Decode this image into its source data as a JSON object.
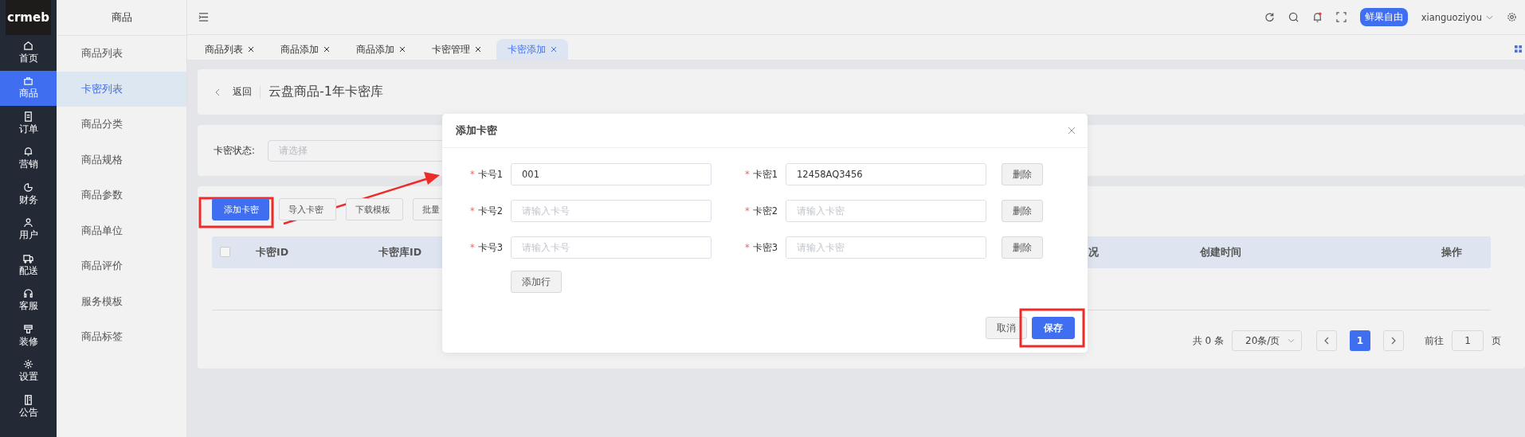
{
  "logo": "crmeb",
  "nav": [
    {
      "label": "首页",
      "selected": false
    },
    {
      "label": "商品",
      "selected": true
    },
    {
      "label": "订单",
      "selected": false
    },
    {
      "label": "营销",
      "selected": false
    },
    {
      "label": "财务",
      "selected": false
    },
    {
      "label": "用户",
      "selected": false
    },
    {
      "label": "配送",
      "selected": false
    },
    {
      "label": "客服",
      "selected": false
    },
    {
      "label": "装修",
      "selected": false
    },
    {
      "label": "设置",
      "selected": false
    },
    {
      "label": "公告",
      "selected": false
    }
  ],
  "submenu": {
    "title": "商品",
    "items": [
      {
        "label": "商品列表",
        "selected": false
      },
      {
        "label": "卡密列表",
        "selected": true
      },
      {
        "label": "商品分类",
        "selected": false
      },
      {
        "label": "商品规格",
        "selected": false
      },
      {
        "label": "商品参数",
        "selected": false
      },
      {
        "label": "商品单位",
        "selected": false
      },
      {
        "label": "商品评价",
        "selected": false
      },
      {
        "label": "服务模板",
        "selected": false
      },
      {
        "label": "商品标签",
        "selected": false
      }
    ]
  },
  "header": {
    "shop": "鲜果自由",
    "username": "xianguoziyou"
  },
  "tabs": [
    {
      "label": "商品列表",
      "selected": false
    },
    {
      "label": "商品添加",
      "selected": false
    },
    {
      "label": "商品添加",
      "selected": false
    },
    {
      "label": "卡密管理",
      "selected": false
    },
    {
      "label": "卡密添加",
      "selected": true
    }
  ],
  "page": {
    "back": "返回",
    "title": "云盘商品-1年卡密库"
  },
  "filter": {
    "label": "卡密状态:",
    "placeholder": "请选择"
  },
  "toolbar": [
    {
      "label": "添加卡密",
      "kind": "primary"
    },
    {
      "label": "导入卡密",
      "kind": "default"
    },
    {
      "label": "下载模板",
      "kind": "default"
    },
    {
      "label": "批量",
      "kind": "default"
    }
  ],
  "table": {
    "all_checked": false,
    "columns": [
      "卡密ID",
      "卡密库ID",
      "况",
      "创建时间",
      "操作"
    ]
  },
  "pagination": {
    "total": "共 0 条",
    "page_size": "20条/页",
    "pages": [
      {
        "label": "1",
        "selected": true
      }
    ],
    "goto": "前往",
    "goto_value": "1",
    "suffix": "页"
  },
  "dialog": {
    "title": "添加卡密",
    "rows": [
      {
        "number": {
          "mark": "*",
          "label": "卡号1",
          "value": "001"
        },
        "secret": {
          "mark": "*",
          "label": "卡密1",
          "value": "12458AQ3456"
        },
        "delete": "删除"
      },
      {
        "number": {
          "mark": "*",
          "label": "卡号2",
          "placeholder": "请输入卡号"
        },
        "secret": {
          "mark": "*",
          "label": "卡密2",
          "placeholder": "请输入卡密"
        },
        "delete": "删除"
      },
      {
        "number": {
          "mark": "*",
          "label": "卡号3",
          "placeholder": "请输入卡号"
        },
        "secret": {
          "mark": "*",
          "label": "卡密3",
          "placeholder": "请输入卡密"
        },
        "delete": "删除"
      }
    ],
    "add_row": "添加行",
    "cancel": "取消",
    "save": "保存"
  }
}
